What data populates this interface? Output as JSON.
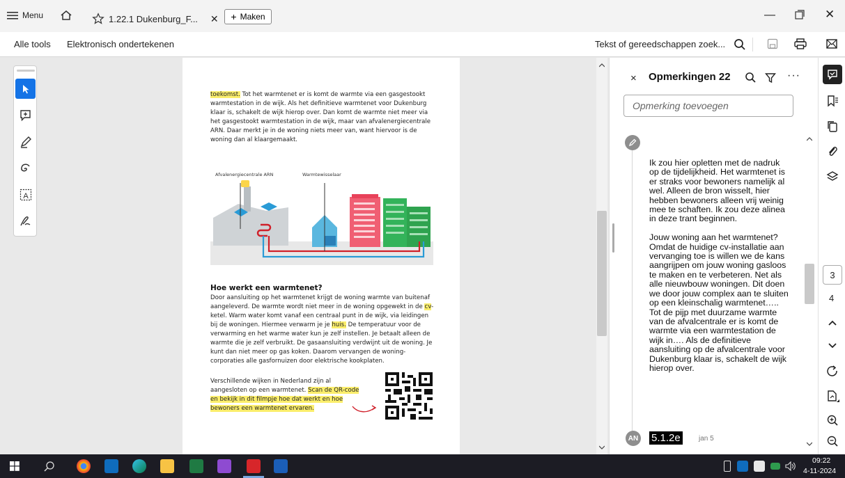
{
  "titlebar": {
    "menu_label": "Menu",
    "tab_title": "1.22.1 Dukenburg_F...",
    "new_tab_label": "Maken"
  },
  "toolbar": {
    "all_tools": "Alle tools",
    "esign": "Elektronisch ondertekenen",
    "search_text": "Tekst of gereedschappen zoek..."
  },
  "document": {
    "para1_hl": "toekomst.",
    "para1": " Tot het warmtenet er is komt de warmte via een gasgestookt warmtestation in de wijk. Als het definitieve warmtenet voor Dukenburg klaar is, schakelt de wijk hierop over. Dan komt de warmte niet meer via het gasgestookt warmtestation in de wijk, maar van afvalenergiecentrale ARN. Daar merkt je in de woning niets meer van, want hiervoor is de woning dan al klaargemaakt.",
    "illus_label1": "Afvalenergiecentrale ARN",
    "illus_label2": "Warmtewisselaar",
    "heading": "Hoe werkt een warmtenet?",
    "para2_a": "Door aansluiting op het warmtenet krijgt de woning warmte van buitenaf aangeleverd. De warmte wordt niet meer in de woning opgewekt in de ",
    "para2_hl1": "cv",
    "para2_b": "-ketel. Warm water komt vanaf een centraal punt in de wijk, via leidingen bij de woningen. Hiermee verwarm je je ",
    "para2_hl2": "huis.",
    "para2_c": " De temperatuur voor de verwarming en het warme water kun je zelf instellen. Je betaalt alleen de warmte die je zelf verbruikt. De gasaansluiting verdwijnt uit de woning. Je kunt dan niet meer op gas koken. Daarom vervangen de woning-corporaties alle gasfornuizen door elektrische kookplaten.",
    "para3_a": "Verschillende wijken in Nederland zijn al aangesloten op een warmtenet. ",
    "para3_hl": "Scan de QR-code en bekijk in dit filmpje hoe dat werkt en hoe bewoners een warmtenet ervaren."
  },
  "comments": {
    "title": "Opmerkingen 22",
    "add_placeholder": "Opmerking toevoegen",
    "comment_body": "Ik zou hier opletten met de nadruk op de tijdelijkheid. Het warmtenet is er straks voor bewoners namelijk al wel. Alleen de bron wisselt, hier hebben bewoners alleen vrij weinig mee te schaften. Ik zou deze alinea in deze trant beginnen.\n\nJouw woning aan het warmtenet? Omdat de huidige cv-installatie aan vervanging toe is willen we de kans aangrijpen om jouw woning gasloos te maken en te verbeteren. Net als alle nieuwbouw woningen. Dit doen we door jouw complex aan te sluiten op een kleinschalig warmtenet….. Tot de pijp met duurzame warmte van de afvalcentrale er is komt de warmte via een warmtestation de wijk in…. Als de definitieve aansluiting op de afvalcentrale voor Dukenburg klaar is, schakelt de wijk hierop over.",
    "next_avatar": "AN",
    "next_ref": "5.1.2e",
    "next_date": "jan 5"
  },
  "rail": {
    "page_current": "3",
    "page_total": "4"
  },
  "taskbar": {
    "time": "09:22",
    "date": "4-11-2024"
  },
  "colors": {
    "accent": "#1473e6",
    "highlight": "#fbee6c",
    "taskbar": "#1c1c24"
  }
}
